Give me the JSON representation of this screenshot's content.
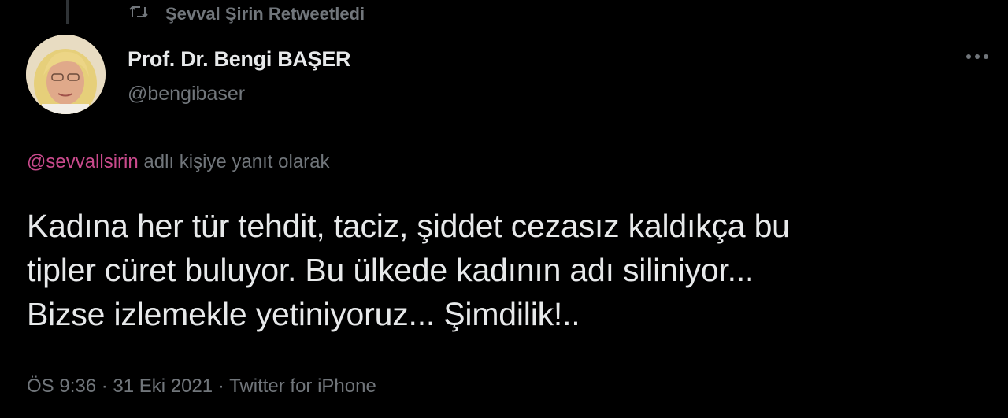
{
  "retweet": {
    "label": "Şevval Şirin Retweetledi",
    "icon": "retweet-icon"
  },
  "author": {
    "name": "Prof. Dr. Bengi BAŞER",
    "handle": "@bengibaser",
    "avatar_icon": "avatar"
  },
  "more_icon": "more-horizontal-icon",
  "reply": {
    "handle": "@sevvallsirin",
    "suffix": " adlı kişiye yanıt olarak"
  },
  "tweet": {
    "line1": "Kadına her tür tehdit, taciz, şiddet cezasız kaldıkça bu",
    "line2": "tipler cüret buluyor. Bu ülkede kadının adı siliniyor...",
    "line3": "Bizse izlemekle yetiniyoruz... Şimdilik!.."
  },
  "meta": {
    "time": "ÖS 9:36",
    "sep1": " · ",
    "date": "31 Eki 2021",
    "sep2": " · ",
    "source": "Twitter for iPhone"
  },
  "colors": {
    "background": "#000000",
    "primary_text": "#e7e9ea",
    "secondary_text": "#71767b",
    "mention": "#c94a8c"
  }
}
